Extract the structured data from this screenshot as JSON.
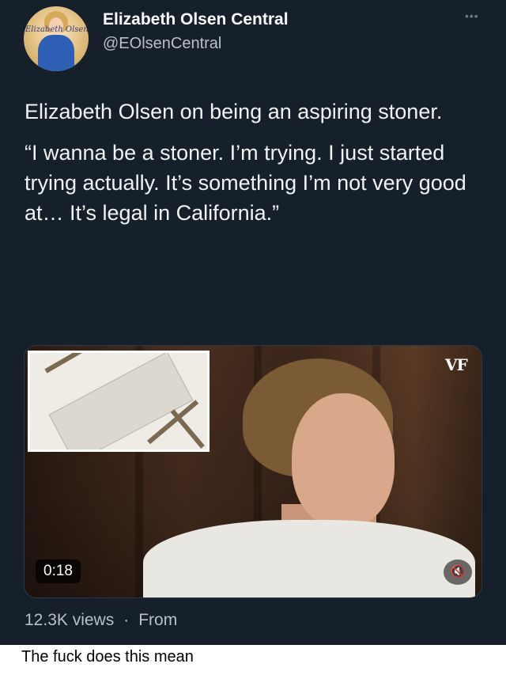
{
  "tweet": {
    "display_name": "Elizabeth Olsen Central",
    "handle": "@EOlsenCentral",
    "avatar_text": "Elizabeth Olsen",
    "more_icon": "ellipsis-icon",
    "text_paragraphs": [
      "Elizabeth Olsen on being an aspiring stoner.",
      "“I wanna be a stoner. I’m trying. I just started trying actually. It’s something I’m not very good at… It’s legal in California.”"
    ],
    "video": {
      "watermark": "VF",
      "timestamp": "0:18",
      "mute_icon": "speaker-muted-icon",
      "mute_glyph": "🔇"
    },
    "views": "12.3K views",
    "separator": "·",
    "from_label": "From"
  },
  "caption": "The fuck does this mean",
  "colors": {
    "tweet_background": "#15202b",
    "tweet_text": "#e7e9ea",
    "secondary_text": "#b9c0c7",
    "page_background": "#ffffff"
  }
}
